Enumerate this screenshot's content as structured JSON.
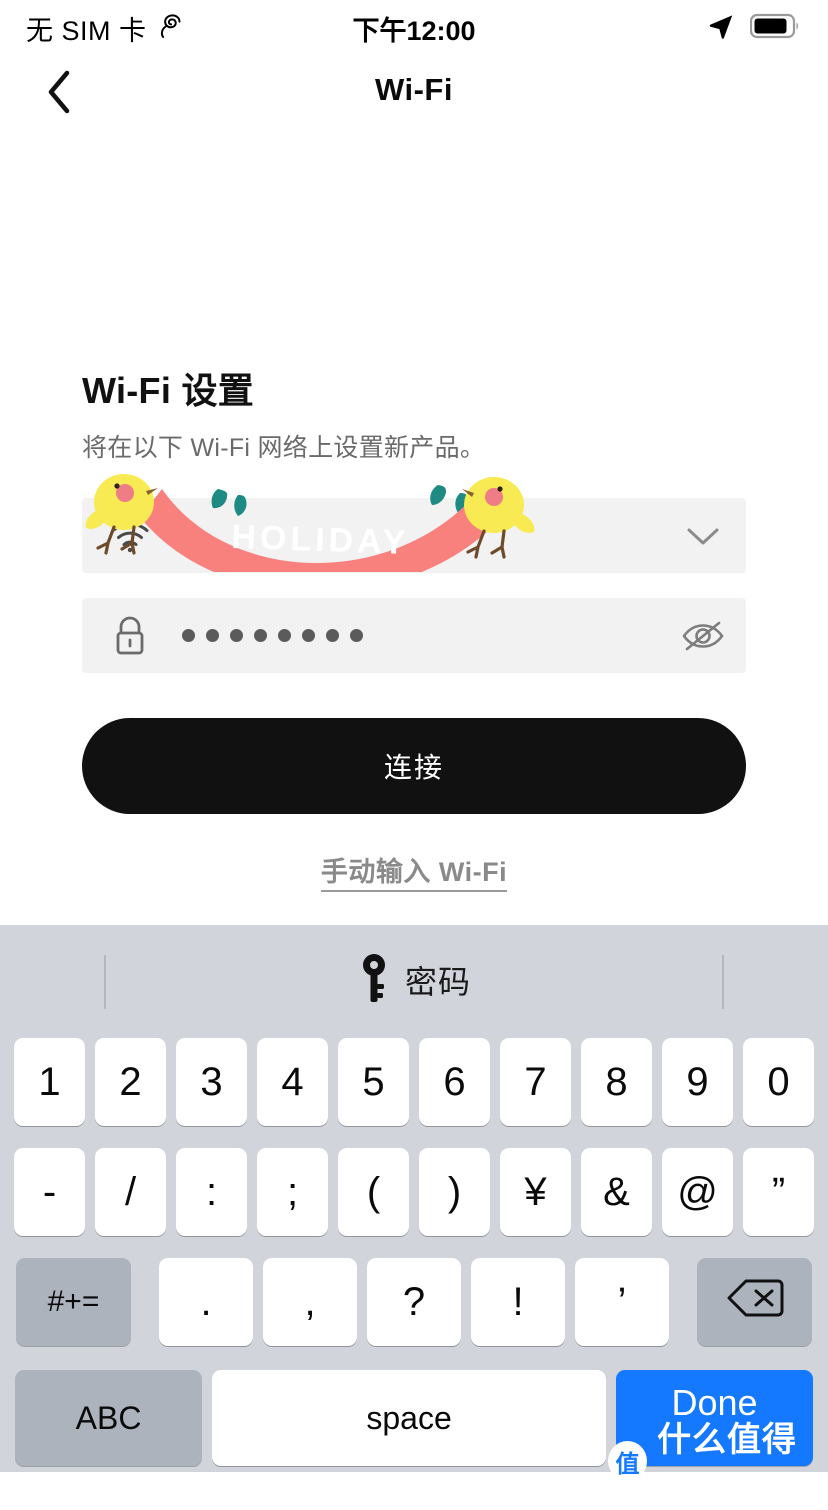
{
  "status_bar": {
    "carrier": "无 SIM 卡",
    "carrier_icon": "sync-loop-icon",
    "time": "下午12:00",
    "location_icon": "location-arrow-icon",
    "battery_icon": "battery-icon",
    "battery_level_pct": 80
  },
  "nav": {
    "back_icon": "chevron-left-icon",
    "title": "Wi-Fi"
  },
  "main": {
    "heading": "Wi-Fi 设置",
    "subheading": "将在以下 Wi-Fi 网络上设置新产品。",
    "ssid_field": {
      "icon": "wifi-icon",
      "value": "",
      "action_icon": "chevron-down-icon",
      "sticker_text": "HOLIDAY"
    },
    "password_field": {
      "icon": "lock-icon",
      "value": "••••••••",
      "dot_count": 8,
      "action_icon": "eye-slash-icon"
    },
    "connect_button": "连接",
    "manual_link": "手动输入 Wi-Fi"
  },
  "keyboard": {
    "toolbar": {
      "icon": "key-icon",
      "label": "密码"
    },
    "row1": [
      "1",
      "2",
      "3",
      "4",
      "5",
      "6",
      "7",
      "8",
      "9",
      "0"
    ],
    "row2": [
      "-",
      "/",
      ":",
      ";",
      "(",
      ")",
      "¥",
      "&",
      "@",
      "”"
    ],
    "row3": {
      "symbols_key": "#+=",
      "keys": [
        ".",
        ",",
        "?",
        "!",
        "’"
      ],
      "backspace_icon": "backspace-icon"
    },
    "row4": {
      "abc": "ABC",
      "space": "space",
      "done": "Done"
    }
  },
  "watermark": {
    "badge": "值",
    "text": "什么值得买"
  },
  "colors": {
    "accent_blue": "#1479ff",
    "button_black": "#111111",
    "field_gray": "#f2f2f2",
    "keyboard_bg": "#d1d5db",
    "key_gray": "#adb3bd",
    "sticker_pink": "#f87f7f",
    "sticker_yellow": "#f7e84b"
  }
}
